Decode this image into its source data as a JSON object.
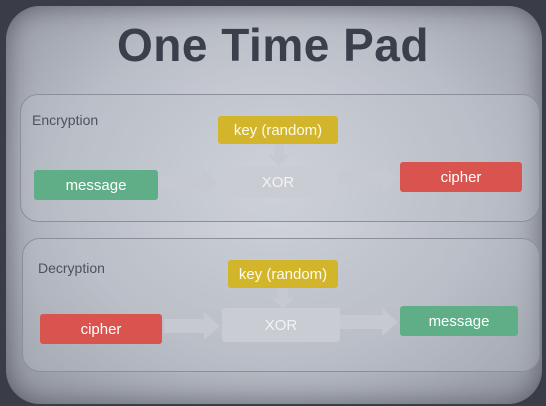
{
  "title": "One Time Pad",
  "encryption": {
    "label": "Encryption",
    "key": "key (random)",
    "input": "message",
    "operation": "XOR",
    "output": "cipher"
  },
  "decryption": {
    "label": "Decryption",
    "key": "key (random)",
    "input": "cipher",
    "operation": "XOR",
    "output": "message"
  },
  "colors": {
    "message": "#5fae88",
    "cipher": "#d9534f",
    "key": "#d3b52c",
    "xor": "#c9ccd2"
  }
}
